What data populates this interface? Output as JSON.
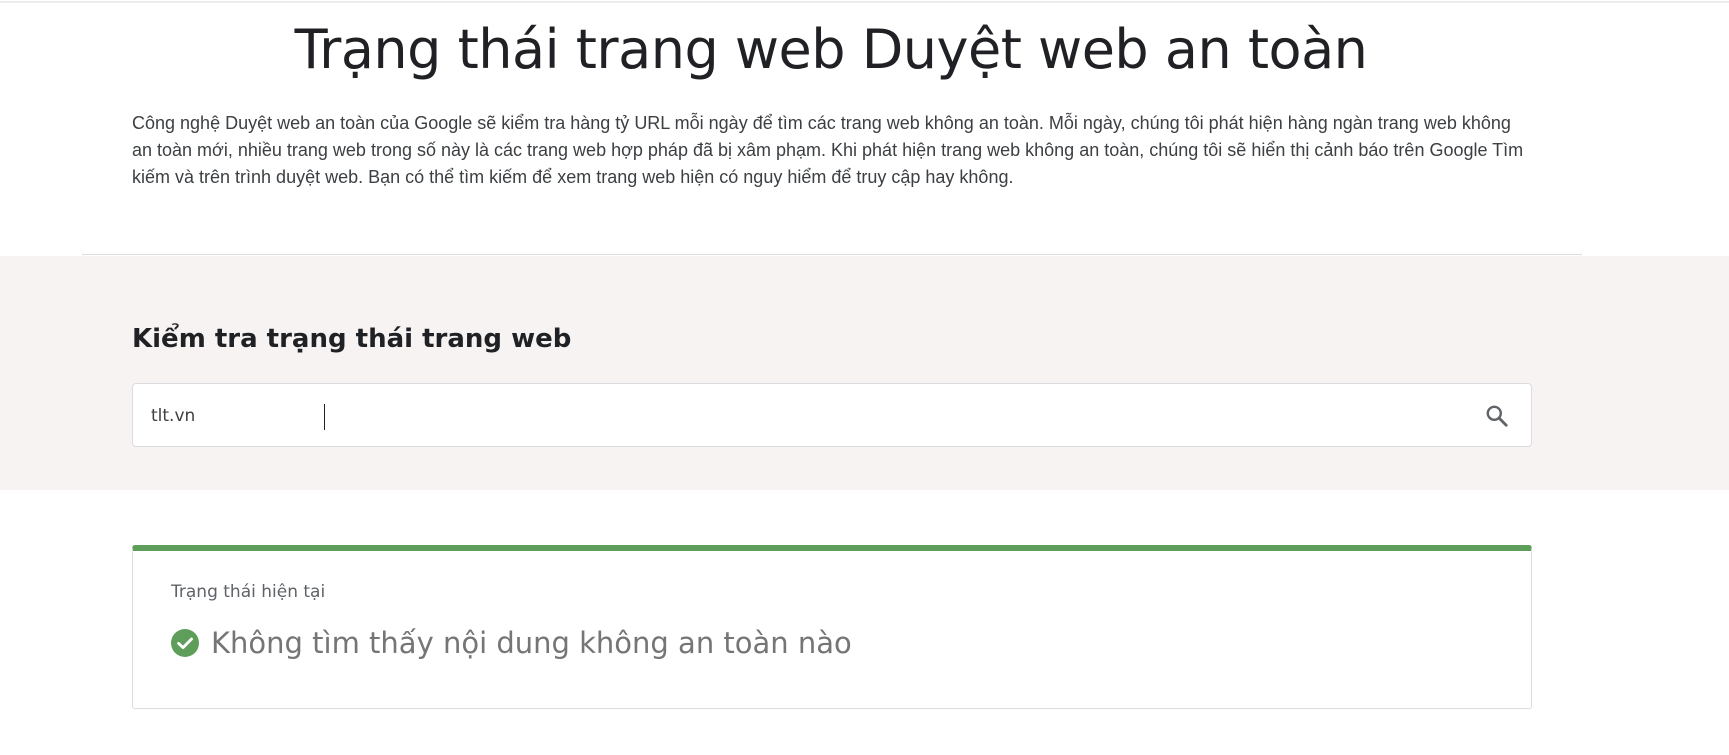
{
  "page": {
    "title": "Trạng thái trang web Duyệt web an toàn",
    "intro": "Công nghệ Duyệt web an toàn của Google sẽ kiểm tra hàng tỷ URL mỗi ngày để tìm các trang web không an toàn. Mỗi ngày, chúng tôi phát hiện hàng ngàn trang web không an toàn mới, nhiều trang web trong số này là các trang web hợp pháp đã bị xâm phạm. Khi phát hiện trang web không an toàn, chúng tôi sẽ hiển thị cảnh báo trên Google Tìm kiếm và trên trình duyệt web. Bạn có thể tìm kiếm để xem trang web hiện có nguy hiểm để truy cập hay không."
  },
  "search": {
    "heading": "Kiểm tra trạng thái trang web",
    "value": "tlt.vn",
    "button_icon": "search-icon"
  },
  "status": {
    "label": "Trạng thái hiện tại",
    "result": "Không tìm thấy nội dung không an toàn nào",
    "icon": "check-circle-icon",
    "accent_color": "#5e9e5a"
  }
}
